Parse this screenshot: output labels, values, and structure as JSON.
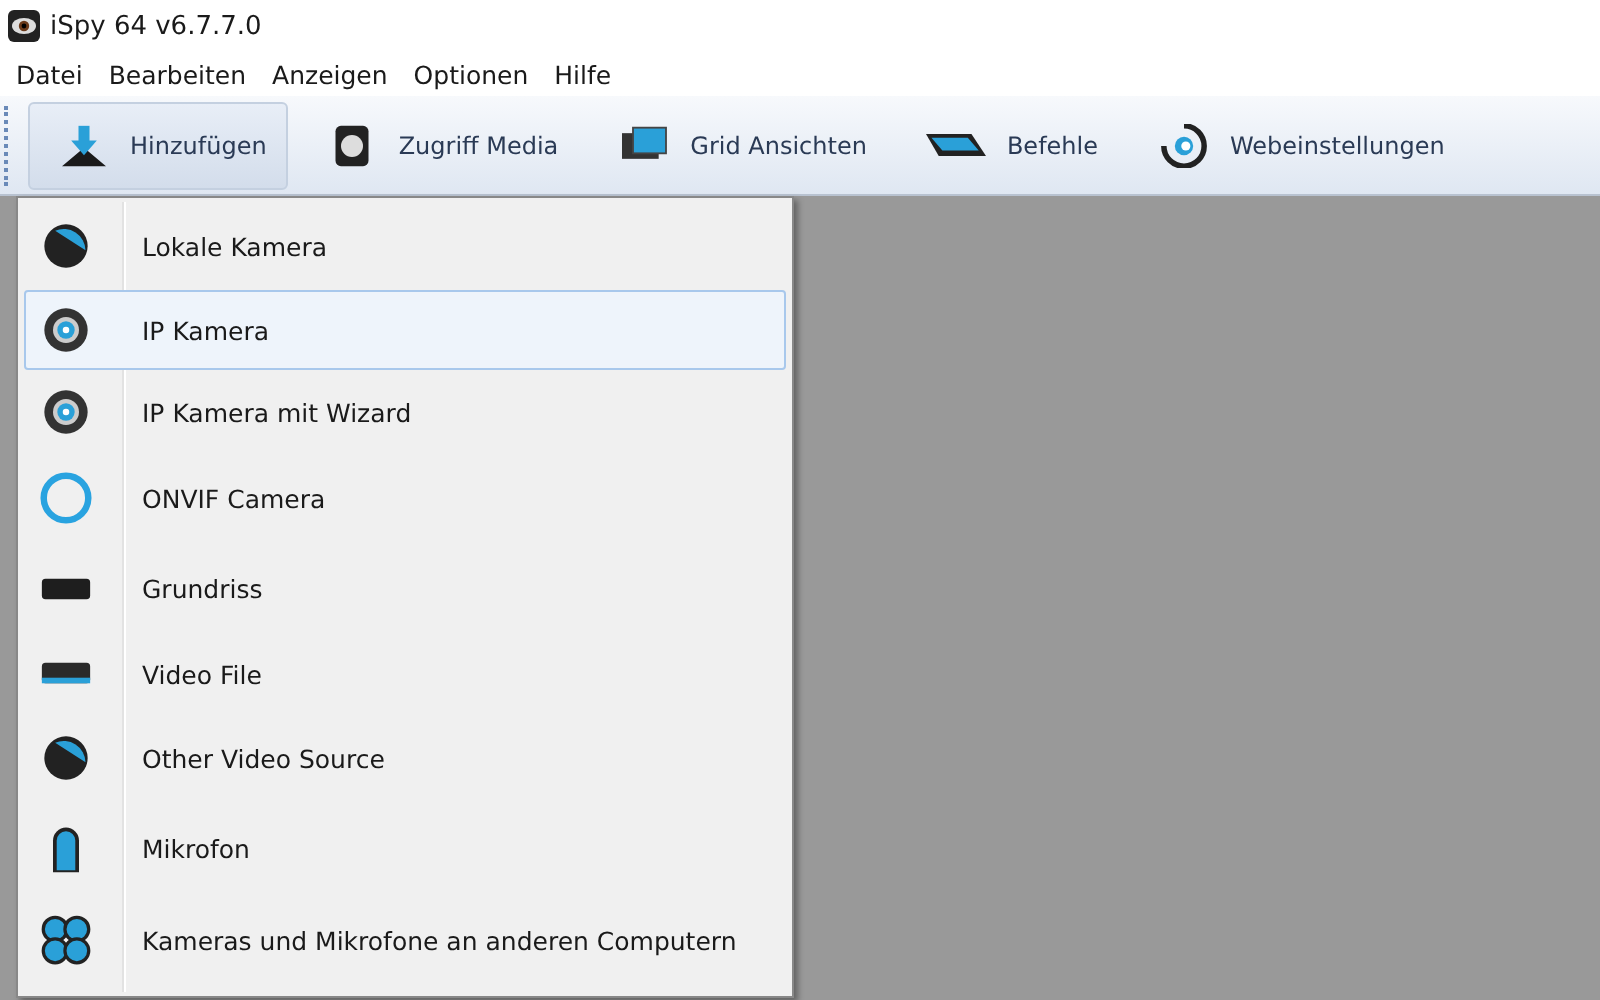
{
  "window": {
    "title": "iSpy 64 v6.7.7.0"
  },
  "menu_bar": [
    "Datei",
    "Bearbeiten",
    "Anzeigen",
    "Optionen",
    "Hilfe"
  ],
  "toolbar": [
    {
      "label": "Hinzufügen",
      "kind": "download",
      "selected": true
    },
    {
      "label": "Zugriff Media",
      "kind": "camera",
      "selected": false
    },
    {
      "label": "Grid Ansichten",
      "kind": "monitor",
      "selected": false
    },
    {
      "label": "Befehle",
      "kind": "wedge",
      "selected": false
    },
    {
      "label": "Webeinstellungen",
      "kind": "dial",
      "selected": false
    }
  ],
  "dropdown": [
    {
      "label": "Lokale Kamera",
      "kind": "disc",
      "selected": false
    },
    {
      "label": "IP Kamera",
      "kind": "target",
      "selected": true
    },
    {
      "label": "IP Kamera mit Wizard",
      "kind": "target",
      "selected": false
    },
    {
      "label": "ONVIF Camera",
      "kind": "ring",
      "selected": false
    },
    {
      "label": "Grundriss",
      "kind": "box",
      "selected": false
    },
    {
      "label": "Video File",
      "kind": "tray",
      "selected": false
    },
    {
      "label": "Other Video Source",
      "kind": "disc",
      "selected": false
    },
    {
      "label": "Mikrofon",
      "kind": "mic",
      "selected": false
    },
    {
      "label": "Kameras und Mikrofone an anderen Computern",
      "kind": "clover",
      "selected": false
    }
  ]
}
